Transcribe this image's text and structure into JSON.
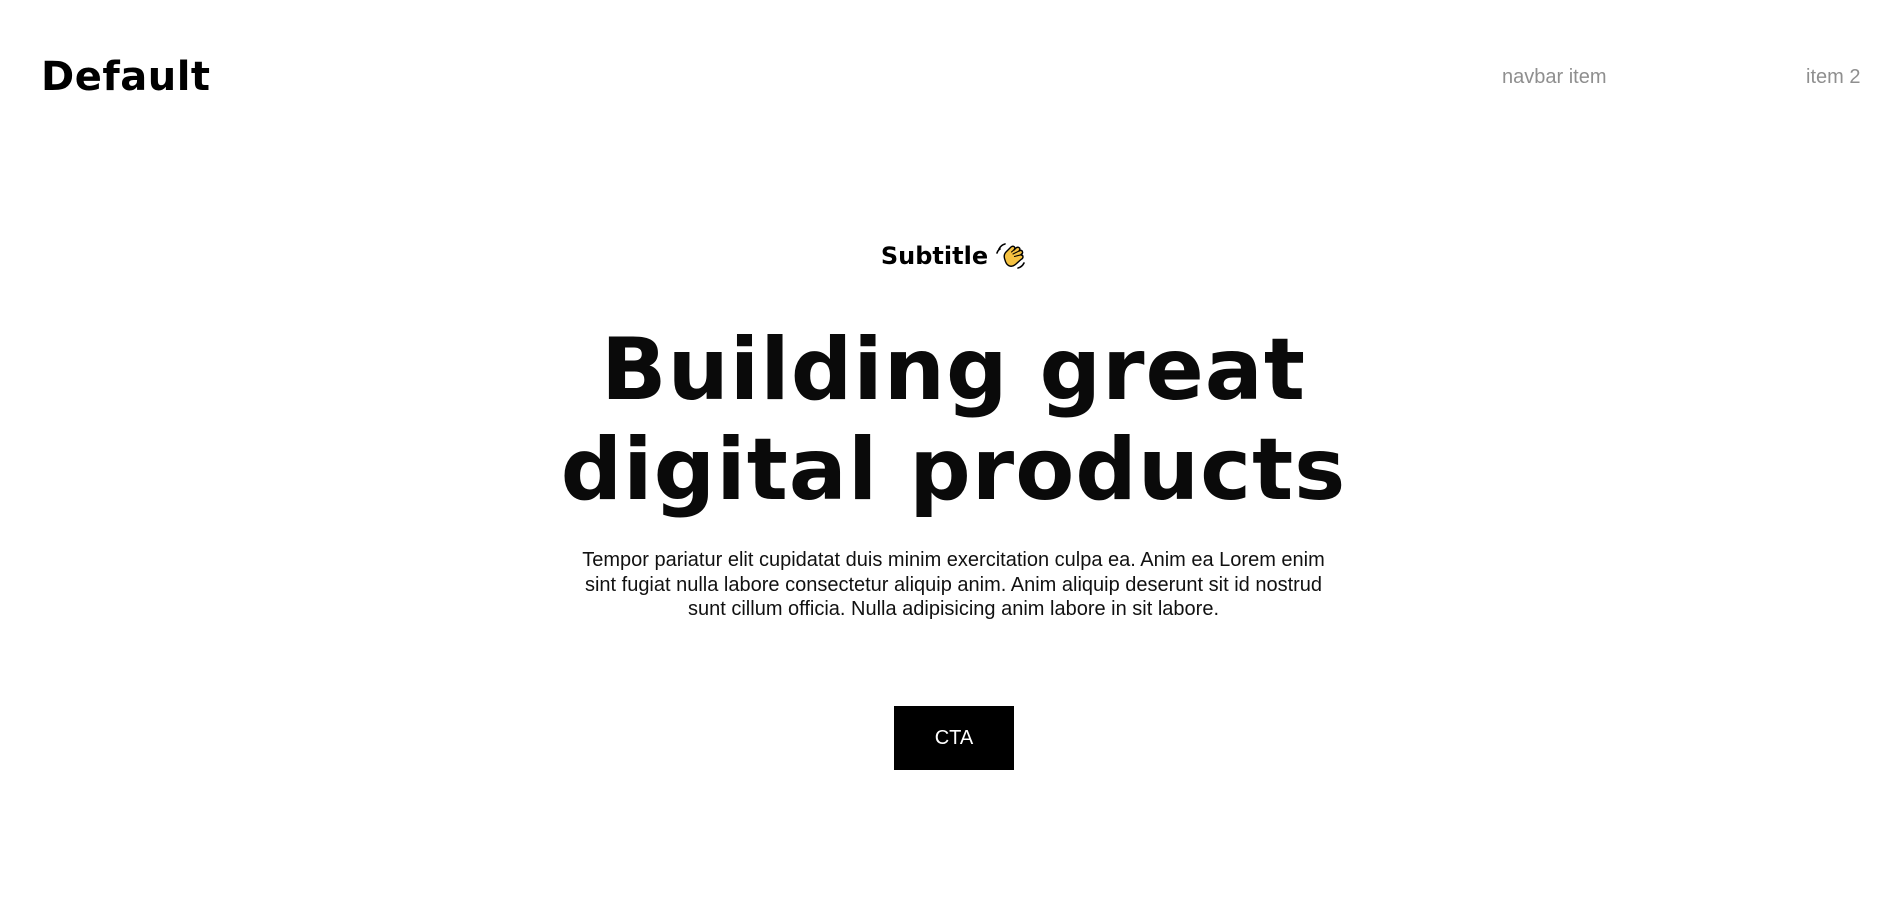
{
  "navbar": {
    "brand": "Default",
    "items": [
      {
        "label": "navbar item"
      },
      {
        "label": "item 2"
      }
    ]
  },
  "hero": {
    "subtitle": "Subtitle",
    "subtitle_icon": "waving-hand-icon",
    "headline_line1": "Building great",
    "headline_line2": "digital products",
    "body": "Tempor pariatur elit cupidatat duis minim exercitation culpa ea. Anim ea Lorem enim sint fugiat nulla labore consectetur aliquip anim. Anim aliquip deserunt sit id nostrud sunt cillum officia. Nulla adipisicing anim labore in sit labore.",
    "cta_label": "CTA"
  },
  "colors": {
    "background": "#ffffff",
    "text": "#0a0a0a",
    "nav_text": "#8f8f8f",
    "cta_background": "#000000",
    "cta_text": "#ffffff",
    "icon_hand": "#f5c242"
  }
}
